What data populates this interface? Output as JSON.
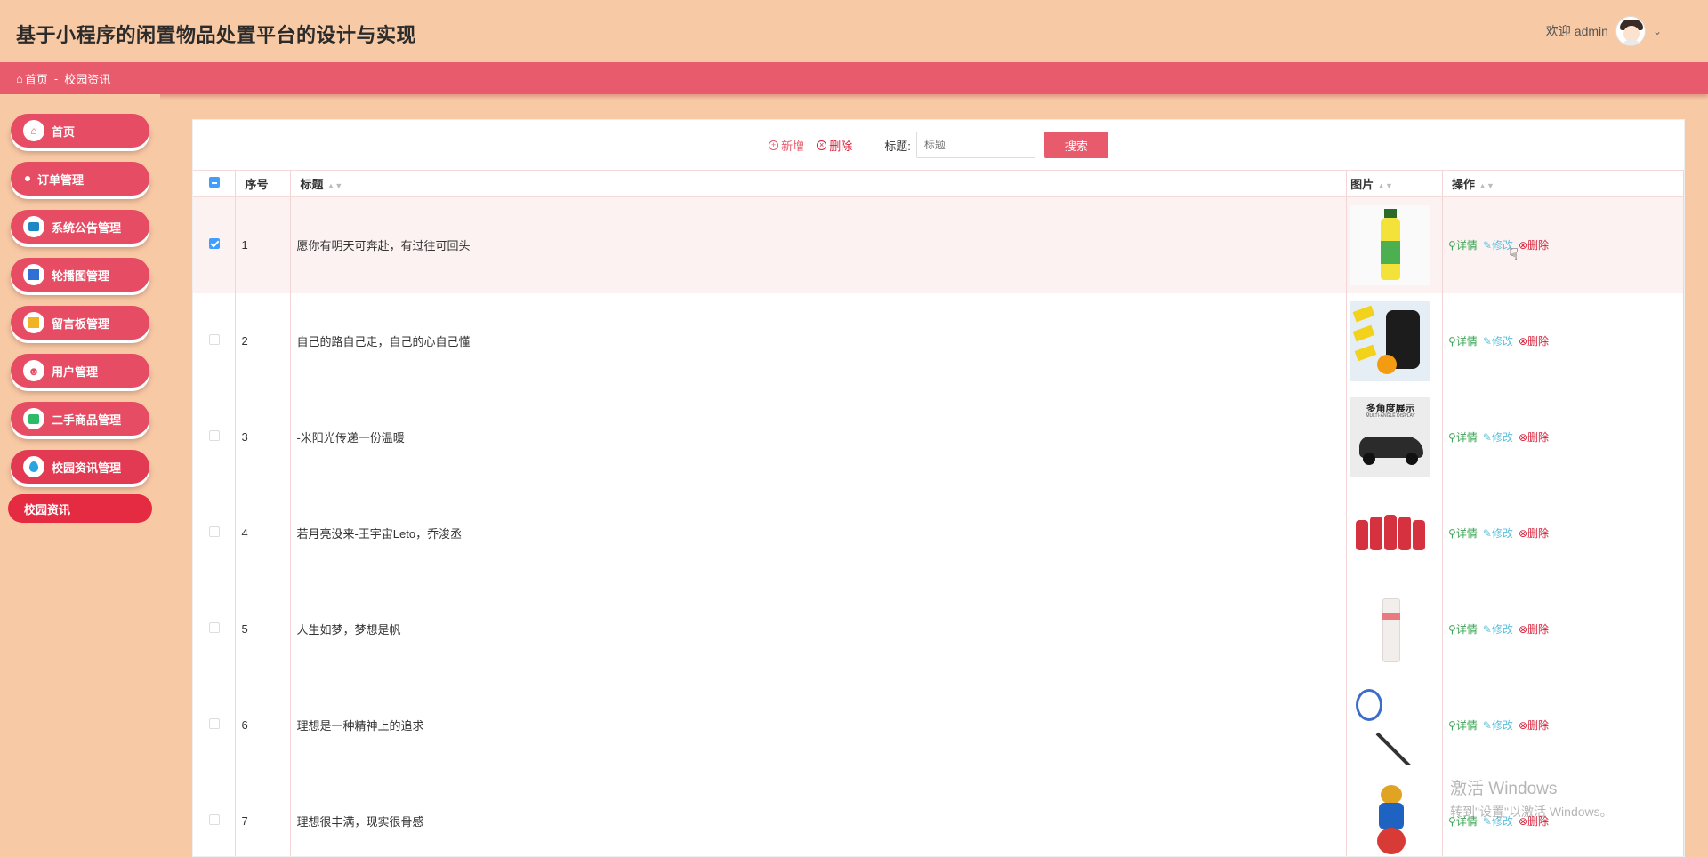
{
  "header": {
    "title": "基于小程序的闲置物品处置平台的设计与实现",
    "welcome": "欢迎 admin"
  },
  "breadcrumb": {
    "home": "首页",
    "separator": "-",
    "current": "校园资讯"
  },
  "sidebar": {
    "items": [
      {
        "label": "首页",
        "icon": "home-icon"
      },
      {
        "label": "订单管理",
        "icon": "dot-icon"
      },
      {
        "label": "系统公告管理",
        "icon": "list-icon"
      },
      {
        "label": "轮播图管理",
        "icon": "grid-icon"
      },
      {
        "label": "留言板管理",
        "icon": "message-icon"
      },
      {
        "label": "用户管理",
        "icon": "user-icon"
      },
      {
        "label": "二手商品管理",
        "icon": "goods-icon"
      },
      {
        "label": "校园资讯管理",
        "icon": "drop-icon"
      }
    ],
    "sub_item": "校园资讯"
  },
  "toolbar": {
    "add_label": "新增",
    "delete_label": "删除",
    "search_label": "标题:",
    "search_placeholder": "标题",
    "search_button": "搜索"
  },
  "table": {
    "headers": {
      "index": "序号",
      "title": "标题",
      "image": "图片",
      "actions": "操作"
    },
    "rows": [
      {
        "index": "1",
        "title": "愿你有明天可奔赴，有过往可回头",
        "selected": true
      },
      {
        "index": "2",
        "title": "自己的路自己走，自己的心自己懂",
        "selected": false
      },
      {
        "index": "3",
        "title": "-米阳光传递一份温暖",
        "selected": false
      },
      {
        "index": "4",
        "title": "若月亮没来-王宇宙Leto，乔浚丞",
        "selected": false
      },
      {
        "index": "5",
        "title": "人生如梦，梦想是帆",
        "selected": false
      },
      {
        "index": "6",
        "title": "理想是一种精神上的追求",
        "selected": false
      },
      {
        "index": "7",
        "title": "理想很丰满，现实很骨感",
        "selected": false
      }
    ],
    "actions": {
      "detail": "详情",
      "edit": "修改",
      "delete": "删除"
    }
  },
  "thumb_texts": {
    "row3_line1": "多角度展示",
    "row3_line2": "MULTI-ANGLE DISPLAY"
  },
  "watermark": {
    "line1": "激活 Windows",
    "line2": "转到\"设置\"以激活 Windows。"
  },
  "colors": {
    "header_bg": "#f7c9a4",
    "accent": "#e75b6c",
    "nav_bg": "#e64c63",
    "detail": "#3aa654",
    "edit": "#5bc0de",
    "delete": "#d3213a"
  }
}
